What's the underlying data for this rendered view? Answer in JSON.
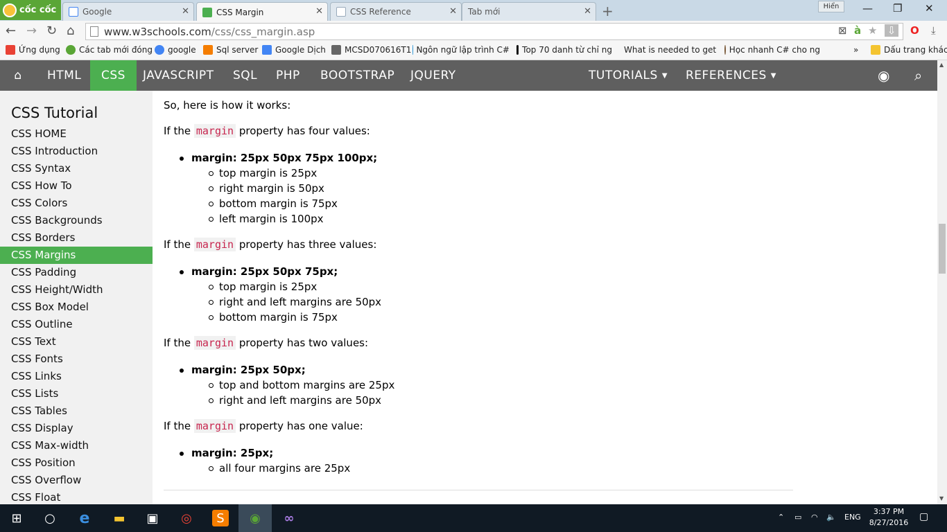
{
  "browser": {
    "logo_text": "cốc cốc",
    "tabs": [
      {
        "title": "Google",
        "favicon_color": "#4285F4"
      },
      {
        "title": "CSS Margin",
        "favicon_color": "#4CAF50"
      },
      {
        "title": "CSS Reference",
        "favicon_color": "#ffffff"
      },
      {
        "title": "Tab mới",
        "favicon_color": ""
      }
    ],
    "user_name": "Hiển",
    "url_host": "www.w3schools.com",
    "url_path": "/css/css_margin.asp"
  },
  "bookmarks": [
    {
      "label": "Ứng dụng",
      "icon": "apps-icon",
      "color": "#e94235"
    },
    {
      "label": "Các tab mới đóng",
      "icon": "history-icon",
      "color": "#5aa636"
    },
    {
      "label": "google",
      "icon": "google-icon",
      "color": "#4285F4"
    },
    {
      "label": "Sql server",
      "icon": "blogger-icon",
      "color": "#f57d00"
    },
    {
      "label": "Google Dịch",
      "icon": "translate-icon",
      "color": "#4285F4"
    },
    {
      "label": "MCSD070616T1",
      "icon": "folder-icon",
      "color": "#666666"
    },
    {
      "label": "Ngôn ngữ lập trình C#",
      "icon": "code-icon",
      "color": "#2a96d6"
    },
    {
      "label": "Top 70 danh từ chỉ ng",
      "icon": "page-icon",
      "color": "#111111"
    },
    {
      "label": "What is needed to get",
      "icon": "avatar-icon",
      "color": "#7a5a3a"
    },
    {
      "label": "Học nhanh C# cho ng",
      "icon": "avatar-icon",
      "color": "#7a5a3a"
    }
  ],
  "bookmarks_overflow": "»",
  "bookmarks_other": "Dấu trang khác",
  "topnav": {
    "items": [
      "HTML",
      "CSS",
      "JAVASCRIPT",
      "SQL",
      "PHP",
      "BOOTSTRAP",
      "JQUERY"
    ],
    "active": "CSS",
    "tutorials": "TUTORIALS",
    "references": "REFERENCES"
  },
  "sidebar": {
    "title": "CSS Tutorial",
    "links": [
      "CSS HOME",
      "CSS Introduction",
      "CSS Syntax",
      "CSS How To",
      "CSS Colors",
      "CSS Backgrounds",
      "CSS Borders",
      "CSS Margins",
      "CSS Padding",
      "CSS Height/Width",
      "CSS Box Model",
      "CSS Outline",
      "CSS Text",
      "CSS Fonts",
      "CSS Links",
      "CSS Lists",
      "CSS Tables",
      "CSS Display",
      "CSS Max-width",
      "CSS Position",
      "CSS Overflow",
      "CSS Float"
    ],
    "active": "CSS Margins"
  },
  "content": {
    "intro": "So, here is how it works:",
    "keyword": "margin",
    "if_the": "If the",
    "four": {
      "suffix": "property has four values:",
      "rule": "margin: 25px 50px 75px 100px;",
      "items": [
        "top margin is 25px",
        "right margin is 50px",
        "bottom margin is 75px",
        "left margin is 100px"
      ]
    },
    "three": {
      "suffix": "property has three values:",
      "rule": "margin: 25px 50px 75px;",
      "items": [
        "top margin is 25px",
        "right and left margins are 50px",
        "bottom margin is 75px"
      ]
    },
    "two": {
      "suffix": "property has two values:",
      "rule": "margin: 25px 50px;",
      "items": [
        "top and bottom margins are 25px",
        "right and left margins are 50px"
      ]
    },
    "one": {
      "suffix": "property has one value:",
      "rule": "margin: 25px;",
      "items": [
        "all four margins are 25px"
      ]
    }
  },
  "taskbar": {
    "language": "ENG",
    "time": "3:37 PM",
    "date": "8/27/2016"
  }
}
